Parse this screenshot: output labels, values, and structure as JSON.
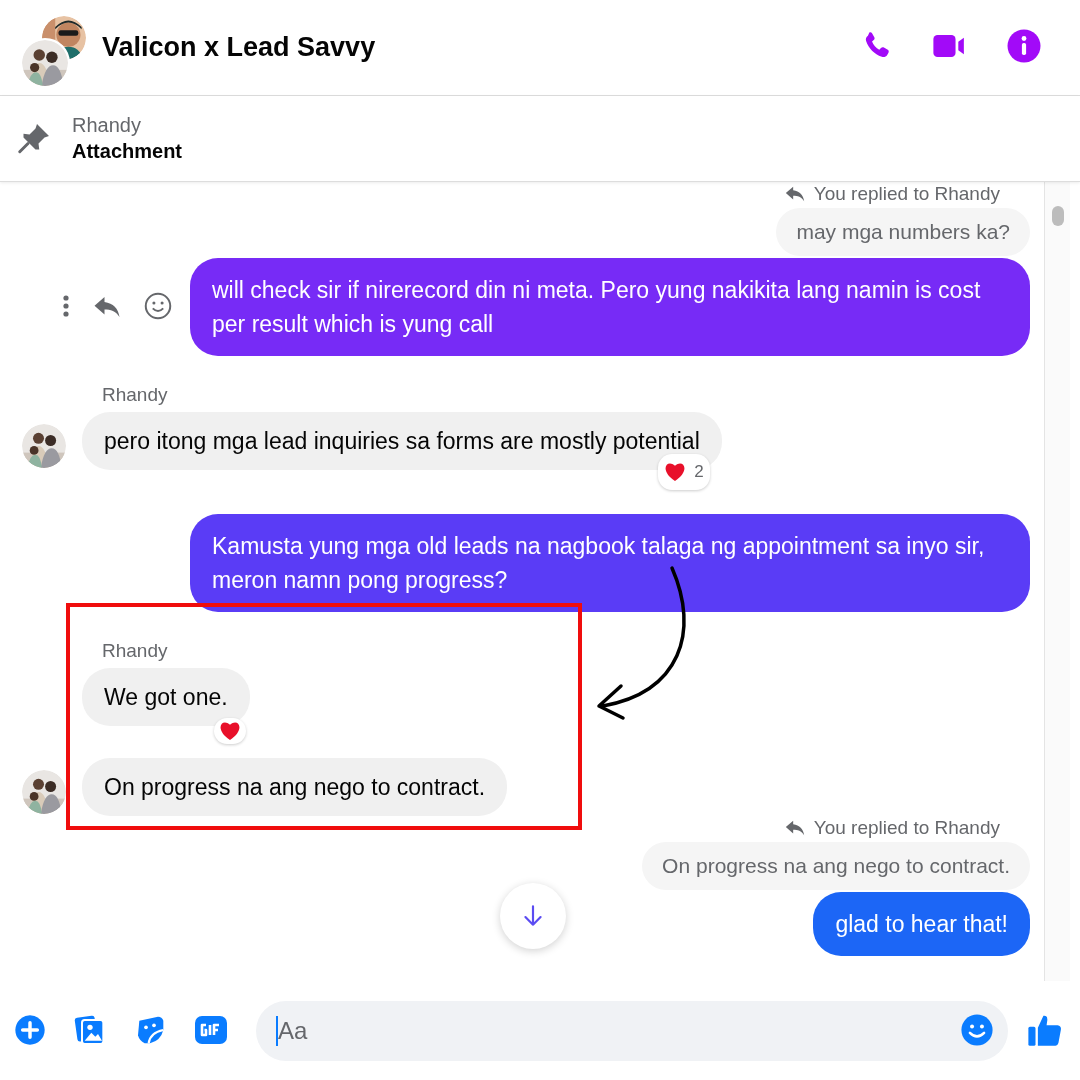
{
  "header": {
    "title": "Valicon x Lead Savvy"
  },
  "pinned": {
    "sender": "Rhandy",
    "label": "Attachment"
  },
  "messages": [
    {
      "kind": "reply_context",
      "label": "You replied to Rhandy",
      "quote": "may mga numbers ka?"
    },
    {
      "kind": "outgoing",
      "text": "will check sir if nirerecord din ni meta. Pero yung nakikita lang namin is cost per result which is yung call",
      "color": "#772bf6",
      "actions_shown": true
    },
    {
      "kind": "incoming",
      "sender": "Rhandy",
      "text": "pero itong mga lead inquiries sa forms are mostly potential",
      "avatar": true,
      "reacted": true,
      "reaction_count": "2"
    },
    {
      "kind": "outgoing",
      "text": "Kamusta yung mga old leads na nagbook talaga ng appointment sa inyo sir, meron namn pong progress?",
      "color": "#5a3cf6",
      "actions_shown": false
    },
    {
      "kind": "incoming",
      "sender": "Rhandy",
      "text": "We got one.",
      "avatar": false,
      "reacted": true
    },
    {
      "kind": "incoming",
      "text": "On progress na ang nego to contract.",
      "avatar": true
    },
    {
      "kind": "reply_context",
      "label": "You replied to Rhandy",
      "quote": "On progress na ang nego to contract."
    },
    {
      "kind": "outgoing",
      "text": "glad to hear that!",
      "color": "#1c66f6",
      "actions_shown": false
    }
  ],
  "composer": {
    "placeholder": "Aa"
  }
}
